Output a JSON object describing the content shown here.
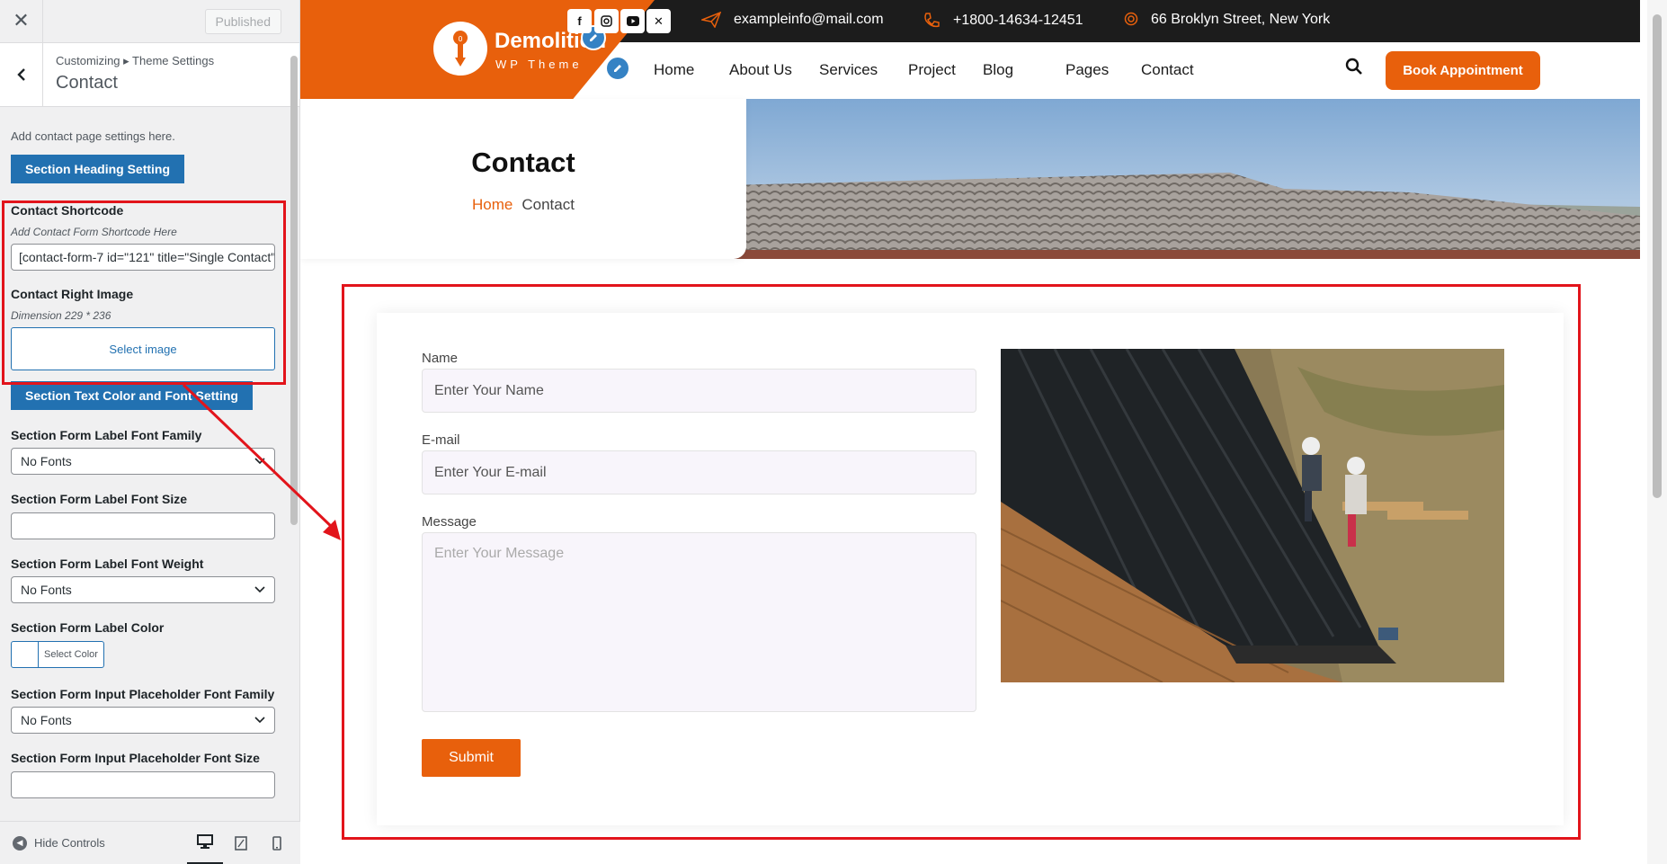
{
  "sidebar": {
    "close_icon": "close-icon",
    "published_label": "Published",
    "breadcrumb": "Customizing ▸ Theme Settings",
    "section_title": "Contact",
    "description": "Add contact page settings here.",
    "heading_setting_button": "Section Heading Setting",
    "contact_shortcode": {
      "title": "Contact Shortcode",
      "desc": "Add Contact Form Shortcode Here",
      "value": "[contact-form-7 id=\"121\" title=\"Single Contact\"]"
    },
    "contact_right_image": {
      "title": "Contact Right Image",
      "desc": "Dimension 229 * 236",
      "button": "Select image"
    },
    "text_color_button": "Section Text Color and Font Setting",
    "label_font_family": {
      "title": "Section Form Label Font Family",
      "value": "No Fonts"
    },
    "label_font_size": {
      "title": "Section Form Label Font Size",
      "value": ""
    },
    "label_font_weight": {
      "title": "Section Form Label Font Weight",
      "value": "No Fonts"
    },
    "label_color": {
      "title": "Section Form Label Color",
      "button": "Select Color"
    },
    "placeholder_font_family": {
      "title": "Section Form Input Placeholder Font Family",
      "value": "No Fonts"
    },
    "placeholder_font_size": {
      "title": "Section Form Input Placeholder Font Size",
      "value": ""
    },
    "hide_controls": "Hide Controls"
  },
  "site": {
    "logo_name": "Demolition",
    "logo_sub": "WP Theme",
    "email": "exampleinfo@mail.com",
    "phone": "+1800-14634-12451",
    "address": "66 Broklyn Street, New York",
    "social": [
      "f",
      "IG",
      "YT",
      "X"
    ],
    "nav": [
      "Home",
      "About Us",
      "Services",
      "Project",
      "Blog",
      "Pages",
      "Contact"
    ],
    "cta": "Book Appointment",
    "accent": "#e8600c",
    "banner": {
      "title": "Contact",
      "crumb_home": "Home",
      "crumb_current": "Contact"
    },
    "form": {
      "name_label": "Name",
      "name_placeholder": "Enter Your Name",
      "email_label": "E-mail",
      "email_placeholder": "Enter Your E-mail",
      "message_label": "Message",
      "message_placeholder": "Enter Your Message",
      "submit": "Submit"
    }
  }
}
